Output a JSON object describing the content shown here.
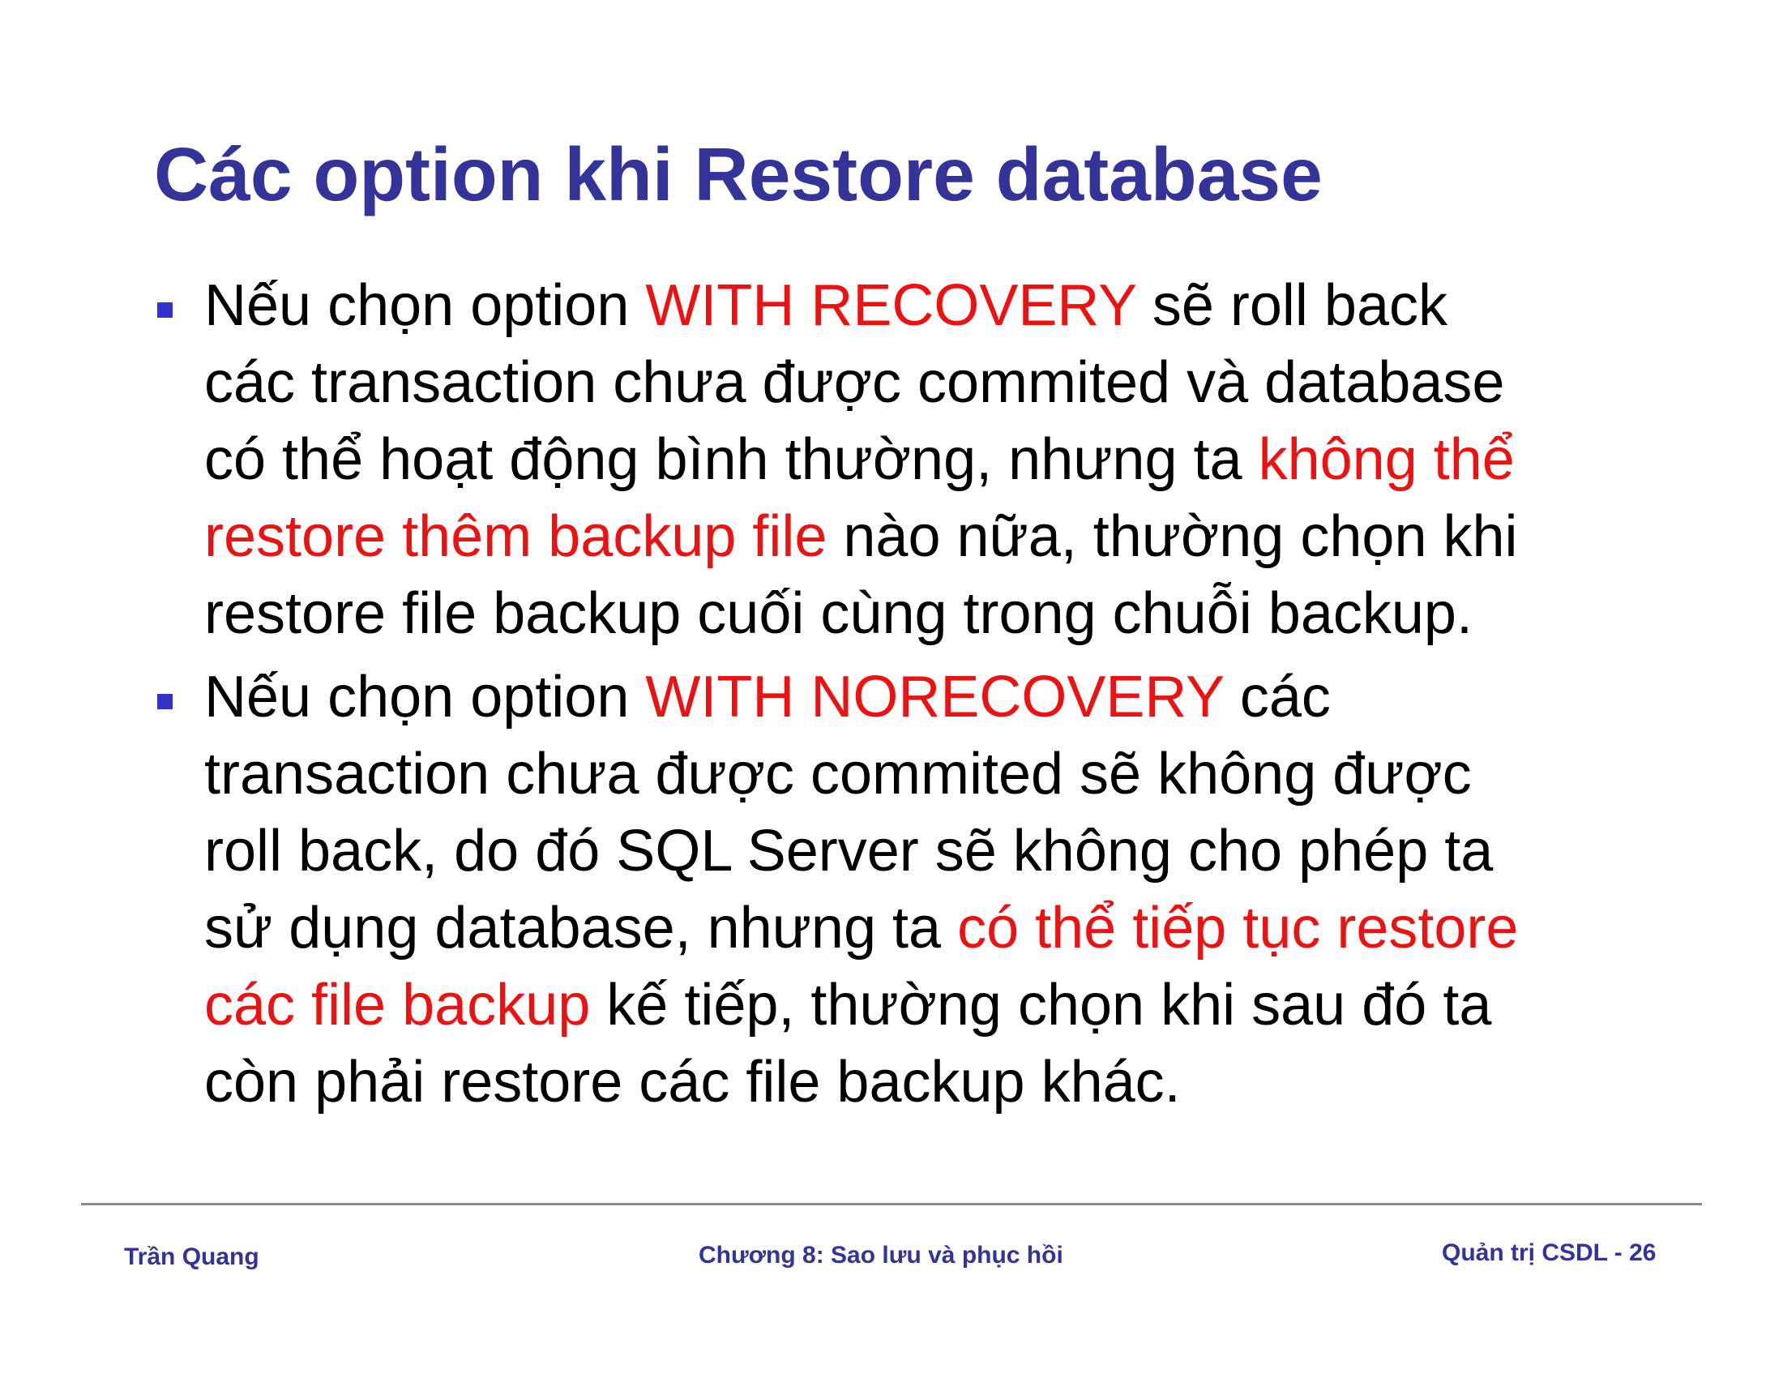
{
  "slide": {
    "title": "Các option khi Restore database",
    "bullets": [
      {
        "lines": [
          [
            {
              "text": "Nếu chọn option ",
              "highlight": false
            },
            {
              "text": "WITH RECOVERY",
              "highlight": true
            },
            {
              "text": " sẽ roll back",
              "highlight": false
            }
          ],
          [
            {
              "text": "các transaction chưa được commited và database",
              "highlight": false
            }
          ],
          [
            {
              "text": "có thể hoạt động bình thường, nhưng ta ",
              "highlight": false
            },
            {
              "text": "không thể",
              "highlight": true
            }
          ],
          [
            {
              "text": "restore thêm backup file",
              "highlight": true
            },
            {
              "text": " nào nữa, thường chọn khi",
              "highlight": false
            }
          ],
          [
            {
              "text": "restore file backup cuối cùng trong chuỗi backup.",
              "highlight": false
            }
          ]
        ]
      },
      {
        "lines": [
          [
            {
              "text": "Nếu chọn option ",
              "highlight": false
            },
            {
              "text": "WITH NORECOVERY",
              "highlight": true
            },
            {
              "text": " các",
              "highlight": false
            }
          ],
          [
            {
              "text": "transaction chưa được commited sẽ không được",
              "highlight": false
            }
          ],
          [
            {
              "text": "roll back, do đó SQL Server sẽ không cho phép ta",
              "highlight": false
            }
          ],
          [
            {
              "text": "sử dụng database, nhưng ta ",
              "highlight": false
            },
            {
              "text": "có thể tiếp tục restore",
              "highlight": true
            }
          ],
          [
            {
              "text": "các file backup",
              "highlight": true
            },
            {
              "text": " kế tiếp, thường chọn khi sau đó ta",
              "highlight": false
            }
          ],
          [
            {
              "text": "còn phải restore các file backup khác.",
              "highlight": false
            }
          ]
        ]
      }
    ]
  },
  "footer": {
    "author": "Trần Quang",
    "chapter": "Chương 8: Sao lưu và phục hồi",
    "course_page": "Quản trị CSDL - 26"
  },
  "colors": {
    "title": "#333399",
    "highlight": "#ee1111",
    "body_text": "#000000",
    "bullet_marker": "#3333cc",
    "footer_text": "#333399",
    "footer_rule": "#8a8a8a"
  },
  "icons": {
    "bullet": "square-bullet-icon"
  }
}
